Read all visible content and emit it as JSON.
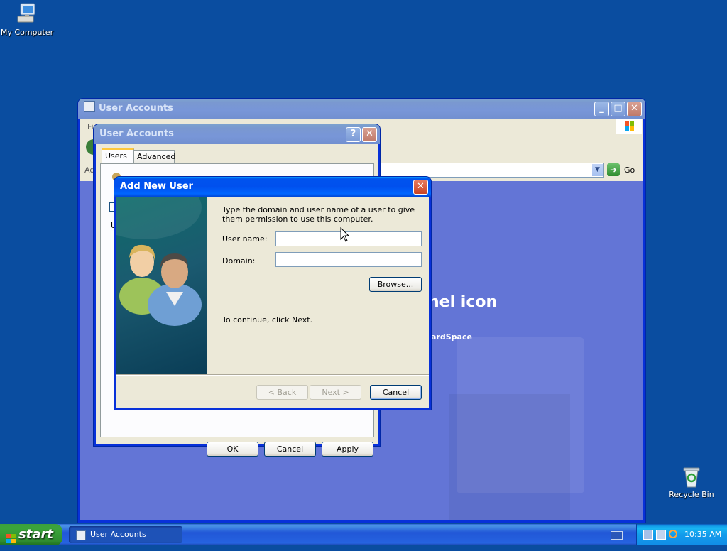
{
  "desktop": {
    "icons": [
      {
        "label": "My Computer",
        "icon": "my-computer-icon"
      },
      {
        "label": "Recycle Bin",
        "icon": "recycle-bin-icon"
      }
    ]
  },
  "main_window": {
    "title": "User Accounts",
    "menu_first_letter": "Fi",
    "address_label": "Ad",
    "go_label": "Go",
    "heading_fragment": "nel icon",
    "sub_fragment": "ardSpace"
  },
  "dialog": {
    "title": "User Accounts",
    "tabs": [
      {
        "label": "Users",
        "active": true
      },
      {
        "label": "Advanced",
        "active": false
      }
    ],
    "fragment_u": "U",
    "buttons": {
      "ok": "OK",
      "cancel": "Cancel",
      "apply": "Apply"
    }
  },
  "wizard": {
    "title": "Add New User",
    "instruction": "Type the domain and user name of a user to give them permission to use this computer.",
    "username_label": "User name:",
    "username_value": "",
    "domain_label": "Domain:",
    "domain_value": "",
    "browse_label": "Browse...",
    "continue_text": "To continue, click Next.",
    "back_label": "< Back",
    "next_label": "Next >",
    "cancel_label": "Cancel"
  },
  "taskbar": {
    "start_label": "start",
    "task_label": "User Accounts",
    "clock": "10:35 AM"
  },
  "colors": {
    "desktop": "#0a4da0",
    "titlebar_active": "#0053ee",
    "dialog_face": "#ece9d8",
    "start_green": "#3ba63b",
    "tray_blue": "#139beb"
  }
}
